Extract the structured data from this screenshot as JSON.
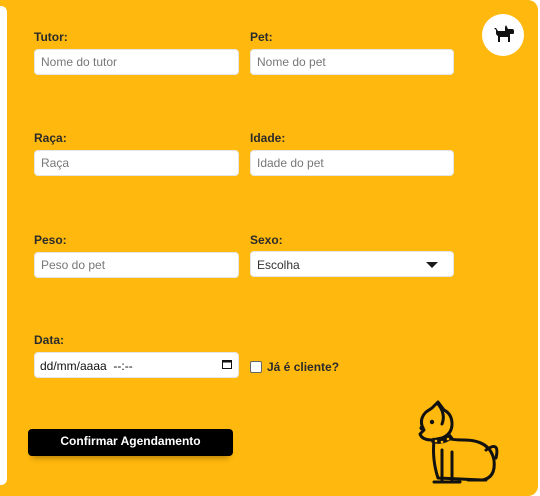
{
  "form": {
    "tutor": {
      "label": "Tutor:",
      "placeholder": "Nome do tutor",
      "value": ""
    },
    "pet": {
      "label": "Pet:",
      "placeholder": "Nome do pet",
      "value": ""
    },
    "breed": {
      "label": "Raça:",
      "placeholder": "Raça",
      "value": ""
    },
    "age": {
      "label": "Idade:",
      "placeholder": "Idade do pet",
      "value": ""
    },
    "weight": {
      "label": "Peso:",
      "placeholder": "Peso do pet",
      "value": ""
    },
    "sex": {
      "label": "Sexo:",
      "selected": "Escolha"
    },
    "date": {
      "label": "Data:",
      "value": "dd/mm/aaaa  --:--"
    },
    "existing_client": {
      "label": "Já é cliente?",
      "checked": false
    },
    "submit_label": "Confirmar Agendamento"
  },
  "colors": {
    "background": "#ffb80d",
    "button": "#000000",
    "button_text": "#ffffff"
  },
  "icons": {
    "logo": "dog-icon",
    "illustration": "sitting-dog-illustration",
    "select": "chevron-down-icon",
    "calendar": "calendar-icon"
  }
}
